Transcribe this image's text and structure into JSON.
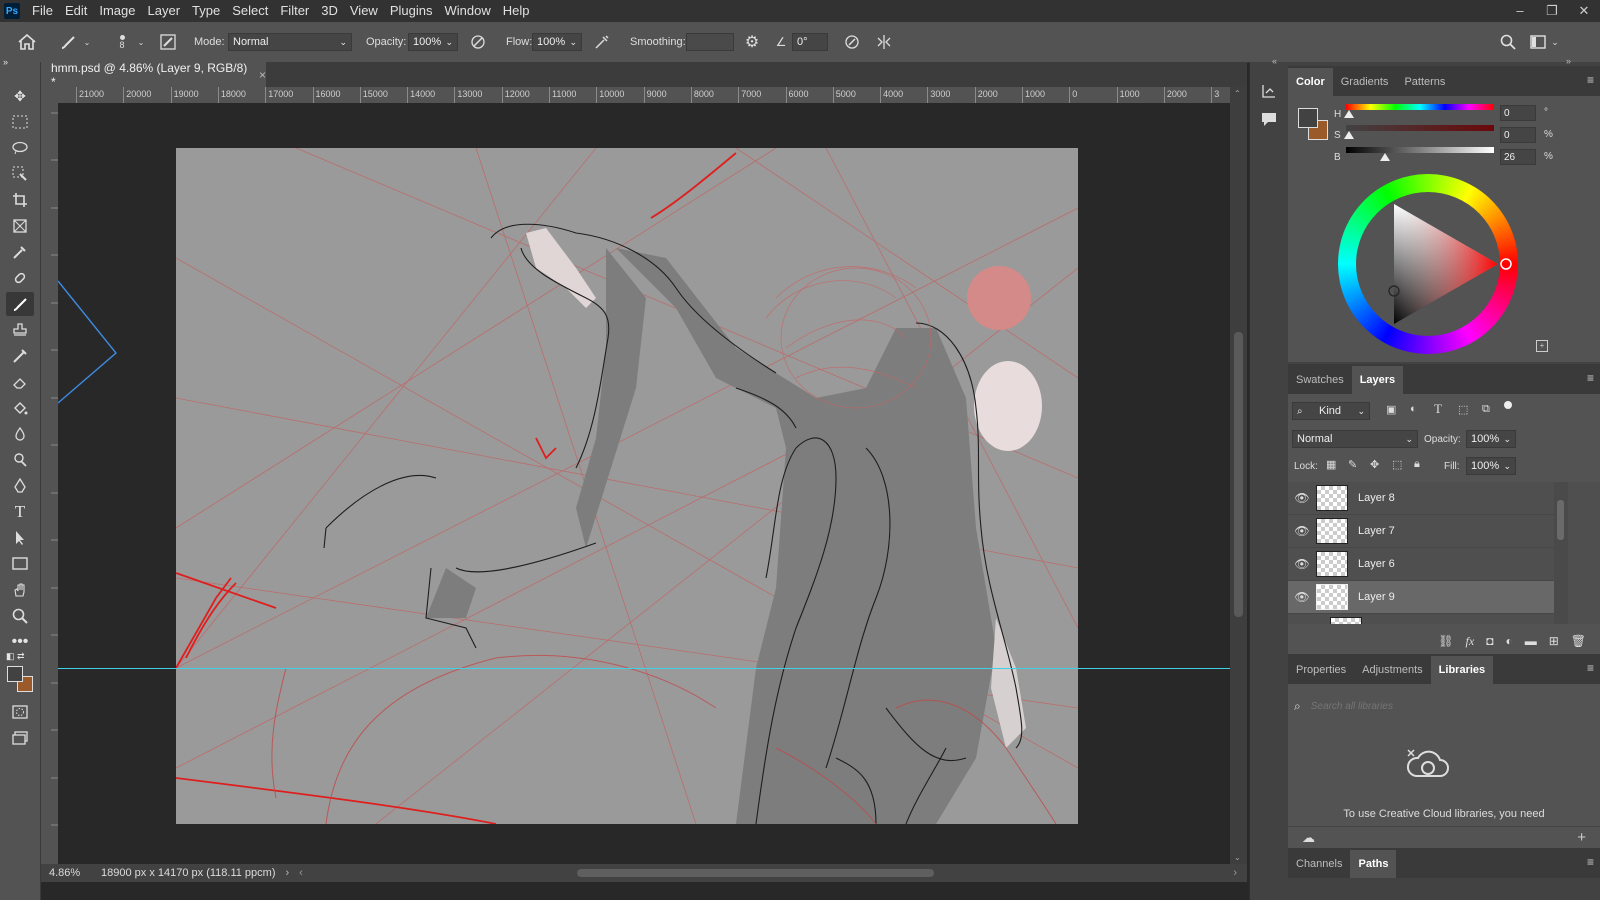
{
  "menubar": {
    "app_icon": "Ps",
    "items": [
      "File",
      "Edit",
      "Image",
      "Layer",
      "Type",
      "Select",
      "Filter",
      "3D",
      "View",
      "Plugins",
      "Window",
      "Help"
    ],
    "window_controls": [
      "–",
      "❐",
      "✕"
    ]
  },
  "options": {
    "brush_size": "8",
    "mode_label": "Mode:",
    "mode_value": "Normal",
    "opacity_label": "Opacity:",
    "opacity_value": "100%",
    "flow_label": "Flow:",
    "flow_value": "100%",
    "smoothing_label": "Smoothing:",
    "smoothing_value": "",
    "angle_value": "0°"
  },
  "document": {
    "tab_title": "hmm.psd @ 4.86% (Layer 9, RGB/8) *",
    "tab_close": "×",
    "ruler_ticks": [
      "21000",
      "20000",
      "19000",
      "18000",
      "17000",
      "16000",
      "15000",
      "14000",
      "13000",
      "12000",
      "11000",
      "10000",
      "9000",
      "8000",
      "7000",
      "6000",
      "5000",
      "4000",
      "3000",
      "2000",
      "1000",
      "0",
      "1000",
      "2000",
      "3"
    ],
    "zoom": "4.86%",
    "doc_info": "18900 px x 14170 px (118.11 ppcm)"
  },
  "color_panel": {
    "tabs": [
      "Color",
      "Gradients",
      "Patterns"
    ],
    "active_tab": "Color",
    "h_label": "H",
    "h_value": "0",
    "h_unit": "°",
    "s_label": "S",
    "s_value": "0",
    "s_unit": "%",
    "b_label": "B",
    "b_value": "26",
    "b_unit": "%",
    "foreground_color": "#424242",
    "background_color": "#9a5a2a"
  },
  "layers_panel": {
    "tabs": [
      "Swatches",
      "Layers"
    ],
    "active_tab": "Layers",
    "filter_label": "Kind",
    "blend_mode": "Normal",
    "opacity_label": "Opacity:",
    "opacity_value": "100%",
    "lock_label": "Lock:",
    "fill_label": "Fill:",
    "fill_value": "100%",
    "layers": [
      {
        "name": "Layer 8",
        "selected": false
      },
      {
        "name": "Layer 7",
        "selected": false
      },
      {
        "name": "Layer 6",
        "selected": false
      },
      {
        "name": "Layer 9",
        "selected": true
      }
    ]
  },
  "libraries_panel": {
    "tabs": [
      "Properties",
      "Adjustments",
      "Libraries"
    ],
    "active_tab": "Libraries",
    "search_placeholder": "Search all libraries",
    "message": "To use Creative Cloud libraries, you need"
  },
  "bottom_panel": {
    "tabs": [
      "Channels",
      "Paths"
    ],
    "active_tab": "Paths"
  }
}
